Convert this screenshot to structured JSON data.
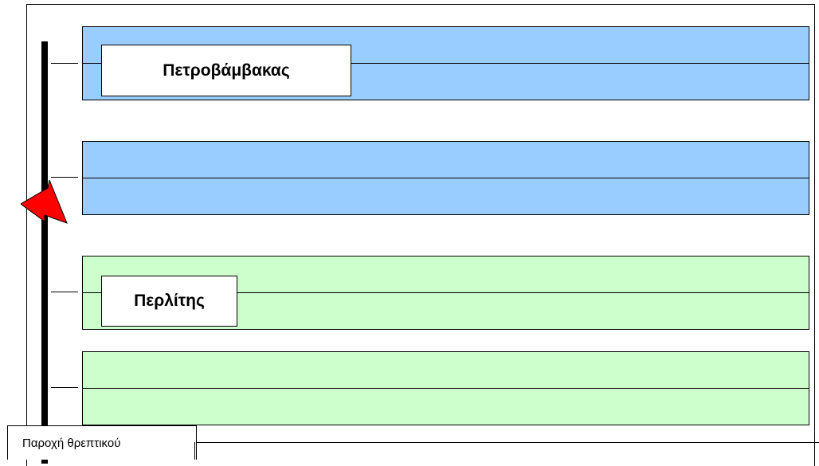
{
  "diagram": {
    "colors": {
      "blue_band": "#99ccff",
      "green_band": "#ccffcc",
      "arrow": "#ff0000",
      "line": "#000000"
    },
    "bands": [
      {
        "label": "Πετροβάμβακας",
        "color": "blue"
      },
      {
        "label": "",
        "color": "blue"
      },
      {
        "label": "Περλίτης",
        "color": "green"
      },
      {
        "label": "",
        "color": "green"
      }
    ],
    "marker_icon": "red-arrow-icon",
    "footer_label": "Παροχή θρεπτικού"
  }
}
